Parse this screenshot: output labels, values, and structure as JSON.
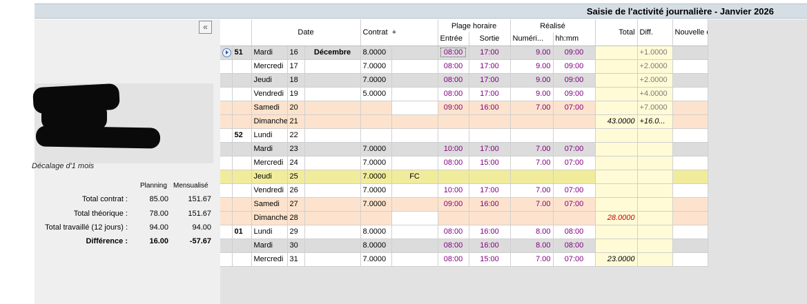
{
  "title": "Saisie de l'activité journalière - Janvier 2026",
  "left": {
    "collapse_icon": "double-chevron-left-icon",
    "collapse_glyph": "«",
    "decalage": "Décalage d'1 mois",
    "stats_headers": [
      "Planning",
      "Mensualisé"
    ],
    "stats": [
      {
        "label": "Total contrat :",
        "planning": "85.00",
        "mensualise": "151.67",
        "bold": false
      },
      {
        "label": "Total théorique :",
        "planning": "78.00",
        "mensualise": "151.67",
        "bold": false
      },
      {
        "label": "Total travaillé (12 jours) :",
        "planning": "94.00",
        "mensualise": "94.00",
        "bold": false
      },
      {
        "label": "Différence :",
        "planning": "16.00",
        "mensualise": "-57.67",
        "bold": true
      }
    ]
  },
  "headers": {
    "date": "Date",
    "contrat": "Contrat",
    "plus": "+",
    "plage": "Plage horaire",
    "entree": "Entrée",
    "sortie": "Sortie",
    "realise": "Réalisé",
    "numeri": "Numéri...",
    "hhmm": "hh:mm",
    "total": "Total",
    "diff": "Diff.",
    "nouvelle": "Nouvelle catégorie"
  },
  "rows": [
    {
      "style": "gray",
      "arrow": true,
      "week": "51",
      "day": "Mardi",
      "num": "16",
      "month": "Décembre",
      "contrat": "8.0000",
      "code": "",
      "entree": "08:00",
      "sortie": "17:00",
      "num_r": "9.00",
      "hhmm": "09:00",
      "total": "",
      "diff": "+1.0000",
      "hatch": false,
      "focus": true
    },
    {
      "style": "white",
      "arrow": false,
      "week": "",
      "day": "Mercredi",
      "num": "17",
      "month": "",
      "contrat": "7.0000",
      "code": "",
      "entree": "08:00",
      "sortie": "17:00",
      "num_r": "9.00",
      "hhmm": "09:00",
      "total": "",
      "diff": "+2.0000",
      "hatch": false
    },
    {
      "style": "gray",
      "arrow": false,
      "week": "",
      "day": "Jeudi",
      "num": "18",
      "month": "",
      "contrat": "7.0000",
      "code": "",
      "entree": "08:00",
      "sortie": "17:00",
      "num_r": "9.00",
      "hhmm": "09:00",
      "total": "",
      "diff": "+2.0000",
      "hatch": false
    },
    {
      "style": "white",
      "arrow": false,
      "week": "",
      "day": "Vendredi",
      "num": "19",
      "month": "",
      "contrat": "5.0000",
      "code": "",
      "entree": "08:00",
      "sortie": "17:00",
      "num_r": "9.00",
      "hhmm": "09:00",
      "total": "",
      "diff": "+4.0000",
      "hatch": false
    },
    {
      "style": "peach",
      "arrow": false,
      "week": "",
      "day": "Samedi",
      "num": "20",
      "month": "",
      "contrat": "",
      "code": "",
      "entree": "09:00",
      "sortie": "16:00",
      "num_r": "7.00",
      "hhmm": "07:00",
      "total": "",
      "diff": "+7.0000",
      "hatch": true
    },
    {
      "style": "peach",
      "arrow": false,
      "week": "",
      "day": "Dimanche",
      "num": "21",
      "month": "",
      "contrat": "",
      "code": "",
      "entree": "",
      "sortie": "",
      "num_r": "",
      "hhmm": "",
      "total": "43.0000",
      "diff": "+16.0...",
      "hatch": false,
      "totalStyle": "black",
      "diffStyle": "black"
    },
    {
      "style": "white",
      "arrow": false,
      "week": "52",
      "day": "Lundi",
      "num": "22",
      "month": "",
      "contrat": "",
      "code": "",
      "entree": "",
      "sortie": "",
      "num_r": "",
      "hhmm": "",
      "total": "",
      "diff": "",
      "hatch": true
    },
    {
      "style": "gray",
      "arrow": false,
      "week": "",
      "day": "Mardi",
      "num": "23",
      "month": "",
      "contrat": "7.0000",
      "code": "",
      "entree": "10:00",
      "sortie": "17:00",
      "num_r": "7.00",
      "hhmm": "07:00",
      "total": "",
      "diff": "",
      "hatch": false
    },
    {
      "style": "white",
      "arrow": false,
      "week": "",
      "day": "Mercredi",
      "num": "24",
      "month": "",
      "contrat": "7.0000",
      "code": "",
      "entree": "08:00",
      "sortie": "15:00",
      "num_r": "7.00",
      "hhmm": "07:00",
      "total": "",
      "diff": "",
      "hatch": false
    },
    {
      "style": "yellow",
      "arrow": false,
      "week": "",
      "day": "Jeudi",
      "num": "25",
      "month": "",
      "contrat": "7.0000",
      "code": "FC",
      "entree": "",
      "sortie": "",
      "num_r": "",
      "hhmm": "",
      "total": "",
      "diff": "",
      "hatch": false
    },
    {
      "style": "white",
      "arrow": false,
      "week": "",
      "day": "Vendredi",
      "num": "26",
      "month": "",
      "contrat": "7.0000",
      "code": "",
      "entree": "10:00",
      "sortie": "17:00",
      "num_r": "7.00",
      "hhmm": "07:00",
      "total": "",
      "diff": "",
      "hatch": false
    },
    {
      "style": "peach",
      "arrow": false,
      "week": "",
      "day": "Samedi",
      "num": "27",
      "month": "",
      "contrat": "7.0000",
      "code": "",
      "entree": "09:00",
      "sortie": "16:00",
      "num_r": "7.00",
      "hhmm": "07:00",
      "total": "",
      "diff": "",
      "hatch": false
    },
    {
      "style": "peach",
      "arrow": false,
      "week": "",
      "day": "Dimanche",
      "num": "28",
      "month": "",
      "contrat": "",
      "code": "",
      "entree": "",
      "sortie": "",
      "num_r": "",
      "hhmm": "",
      "total": "28.0000",
      "diff": "",
      "hatch": true,
      "totalStyle": "red"
    },
    {
      "style": "white",
      "arrow": false,
      "week": "01",
      "day": "Lundi",
      "num": "29",
      "month": "",
      "contrat": "8.0000",
      "code": "",
      "entree": "08:00",
      "sortie": "16:00",
      "num_r": "8.00",
      "hhmm": "08:00",
      "total": "",
      "diff": "",
      "hatch": false
    },
    {
      "style": "gray",
      "arrow": false,
      "week": "",
      "day": "Mardi",
      "num": "30",
      "month": "",
      "contrat": "8.0000",
      "code": "",
      "entree": "08:00",
      "sortie": "16:00",
      "num_r": "8.00",
      "hhmm": "08:00",
      "total": "",
      "diff": "",
      "hatch": false
    },
    {
      "style": "white",
      "arrow": false,
      "week": "",
      "day": "Mercredi",
      "num": "31",
      "month": "",
      "contrat": "7.0000",
      "code": "",
      "entree": "08:00",
      "sortie": "15:00",
      "num_r": "7.00",
      "hhmm": "07:00",
      "total": "23.0000",
      "diff": "",
      "hatch": false,
      "totalStyle": "black"
    }
  ]
}
